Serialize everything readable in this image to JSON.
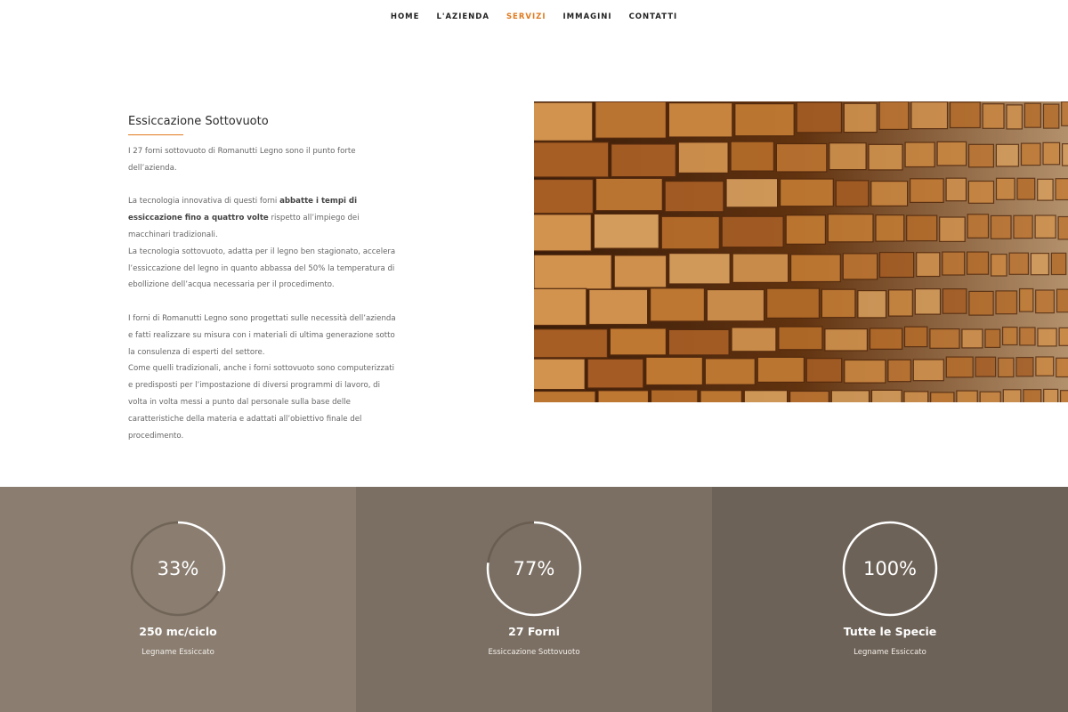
{
  "nav": {
    "items": [
      {
        "label": "HOME",
        "active": false
      },
      {
        "label": "L'AZIENDA",
        "active": false
      },
      {
        "label": "SERVIZI",
        "active": true
      },
      {
        "label": "IMMAGINI",
        "active": false
      },
      {
        "label": "CONTATTI",
        "active": false
      }
    ]
  },
  "section": {
    "title": "Essiccazione Sottovuoto",
    "p1": "I 27 forni sottovuoto di Romanutti Legno sono il punto forte dell’azienda.",
    "p2_pre": "La tecnologia innovativa di questi forni ",
    "p2_bold": "abbatte i tempi di essiccazione fino a quattro volte",
    "p2_post": " rispetto all’impiego dei macchinari tradizionali.",
    "p3": "La tecnologia sottovuoto, adatta per il legno ben stagionato, accelera l’essiccazione del legno in quanto abbassa del 50% la temperatura di ebollizione dell’acqua necessaria per il procedimento.",
    "p4": "I forni di Romanutti Legno sono progettati sulle necessità dell’azienda e fatti realizzare su misura con i materiali di ultima generazione sotto la consulenza di esperti del settore.",
    "p5": "Come quelli tradizionali, anche i forni sottovuoto sono computerizzati e predisposti per l’impostazione di diversi programmi di lavoro, di volta in volta messi a punto dal personale sulla base delle caratteristiche della materia e adattati all’obiettivo finale del procedimento."
  },
  "stats": [
    {
      "value": "33%",
      "percent": 33,
      "title": "250 mc/ciclo",
      "subtitle": "Legname Essiccato",
      "bg": "#8b7e71"
    },
    {
      "value": "77%",
      "percent": 77,
      "title": "27 Forni",
      "subtitle": "Essiccazione Sottovuoto",
      "bg": "#7b6f63"
    },
    {
      "value": "100%",
      "percent": 100,
      "title": "Tutte le Specie",
      "subtitle": "Legname Essiccato",
      "bg": "#6d6257"
    }
  ],
  "colors": {
    "accent": "#e07a1f",
    "ring": "#ffffff"
  }
}
